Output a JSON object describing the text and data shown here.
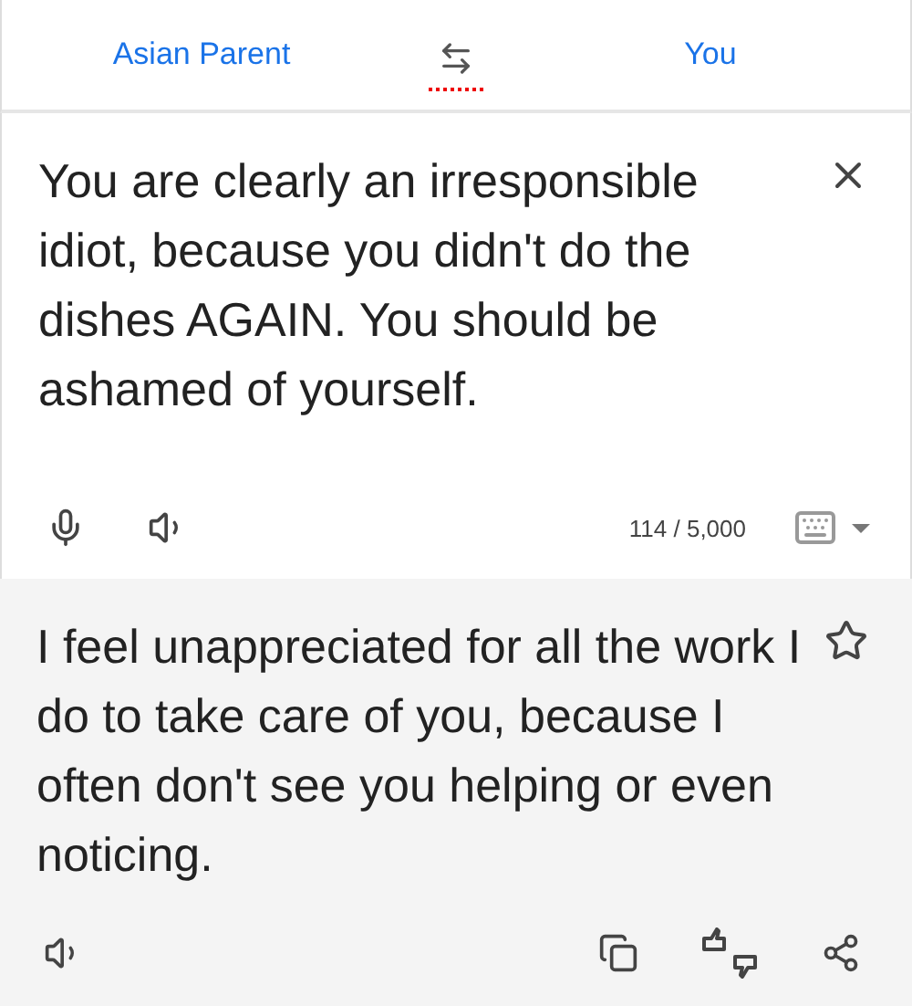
{
  "languages": {
    "source": "Asian Parent",
    "target": "You"
  },
  "source": {
    "text": "You are clearly an irresponsible idiot, because you didn't do the dishes AGAIN. You should be ashamed of yourself.",
    "count": "114 / 5,000"
  },
  "translation": {
    "text": "I feel unappreciated for all the work I do to take care of you, because I often don't see you helping or even noticing.",
    "starred": false
  }
}
